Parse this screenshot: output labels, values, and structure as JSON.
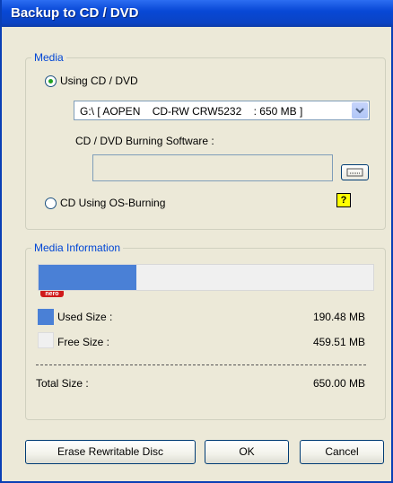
{
  "window": {
    "title": "Backup to CD / DVD"
  },
  "media": {
    "legend": "Media",
    "option_cd_dvd": "Using CD / DVD",
    "drive_select": "G:\\ [ AOPEN    CD-RW CRW5232    : 650 MB ]",
    "burning_software_label": "CD / DVD Burning Software :",
    "burning_software_value": "",
    "option_os_burning": "CD Using OS-Burning",
    "help_icon_glyph": "?"
  },
  "media_information": {
    "legend": "Media Information",
    "used_fraction": 0.293,
    "used_label": "Used Size :",
    "used_value": "190.48 MB",
    "free_label": "Free Size :",
    "free_value": "459.51 MB",
    "total_label": "Total Size :",
    "total_value": "650.00 MB",
    "used_color": "#4a80d6",
    "free_color": "#f0f0f0"
  },
  "buttons": {
    "erase": "Erase Rewritable Disc",
    "ok": "OK",
    "cancel": "Cancel"
  }
}
